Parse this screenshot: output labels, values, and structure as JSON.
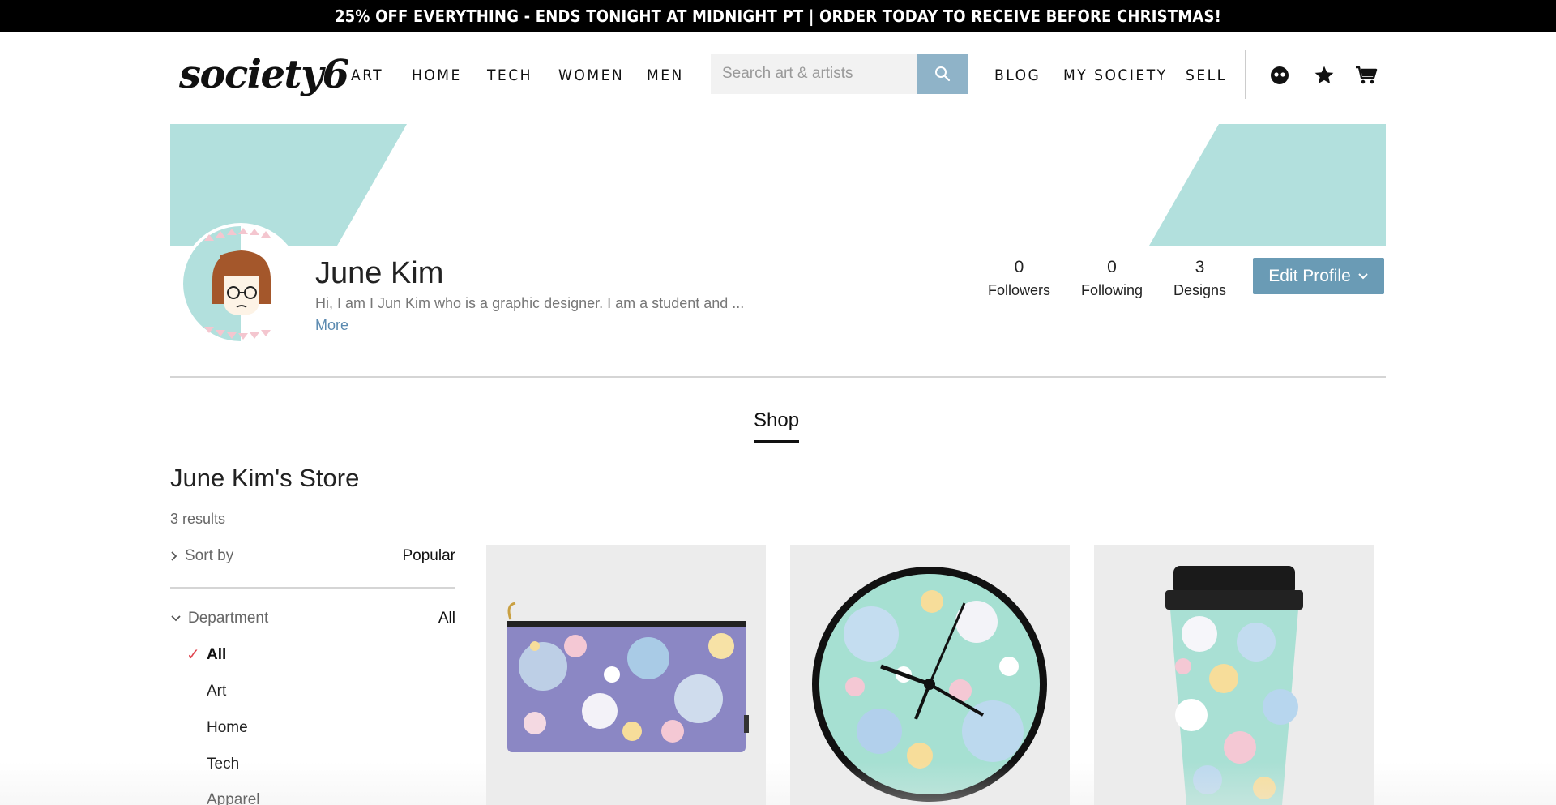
{
  "promo": {
    "text": "25% OFF EVERYTHING - ENDS TONIGHT AT MIDNIGHT PT | ORDER TODAY TO RECEIVE BEFORE CHRISTMAS!"
  },
  "header": {
    "logo": "society6",
    "nav": [
      "ART",
      "HOME",
      "TECH",
      "WOMEN",
      "MEN"
    ],
    "search_placeholder": "Search art & artists",
    "nav_right": [
      "BLOG",
      "MY SOCIETY",
      "SELL"
    ],
    "icons": [
      "profile-icon",
      "star-icon",
      "cart-icon"
    ]
  },
  "colors": {
    "accent": "#6a9bb5",
    "cover": "#b2e0dd",
    "check": "#e0454f"
  },
  "profile": {
    "name": "June Kim",
    "bio": "Hi, I am I Jun Kim who is a graphic designer. I am a student and ...",
    "more": "More",
    "stats": [
      {
        "num": "0",
        "label": "Followers"
      },
      {
        "num": "0",
        "label": "Following"
      },
      {
        "num": "3",
        "label": "Designs"
      }
    ],
    "edit_label": "Edit Profile"
  },
  "shop": {
    "tab": "Shop",
    "store_title": "June Kim's Store",
    "results": "3 results",
    "sort_label": "Sort by",
    "sort_value": "Popular",
    "department_label": "Department",
    "department_value": "All",
    "departments": [
      "All",
      "Art",
      "Home",
      "Tech",
      "Apparel"
    ]
  },
  "products": [
    "carry-all-pouch",
    "wall-clock",
    "travel-mug"
  ]
}
